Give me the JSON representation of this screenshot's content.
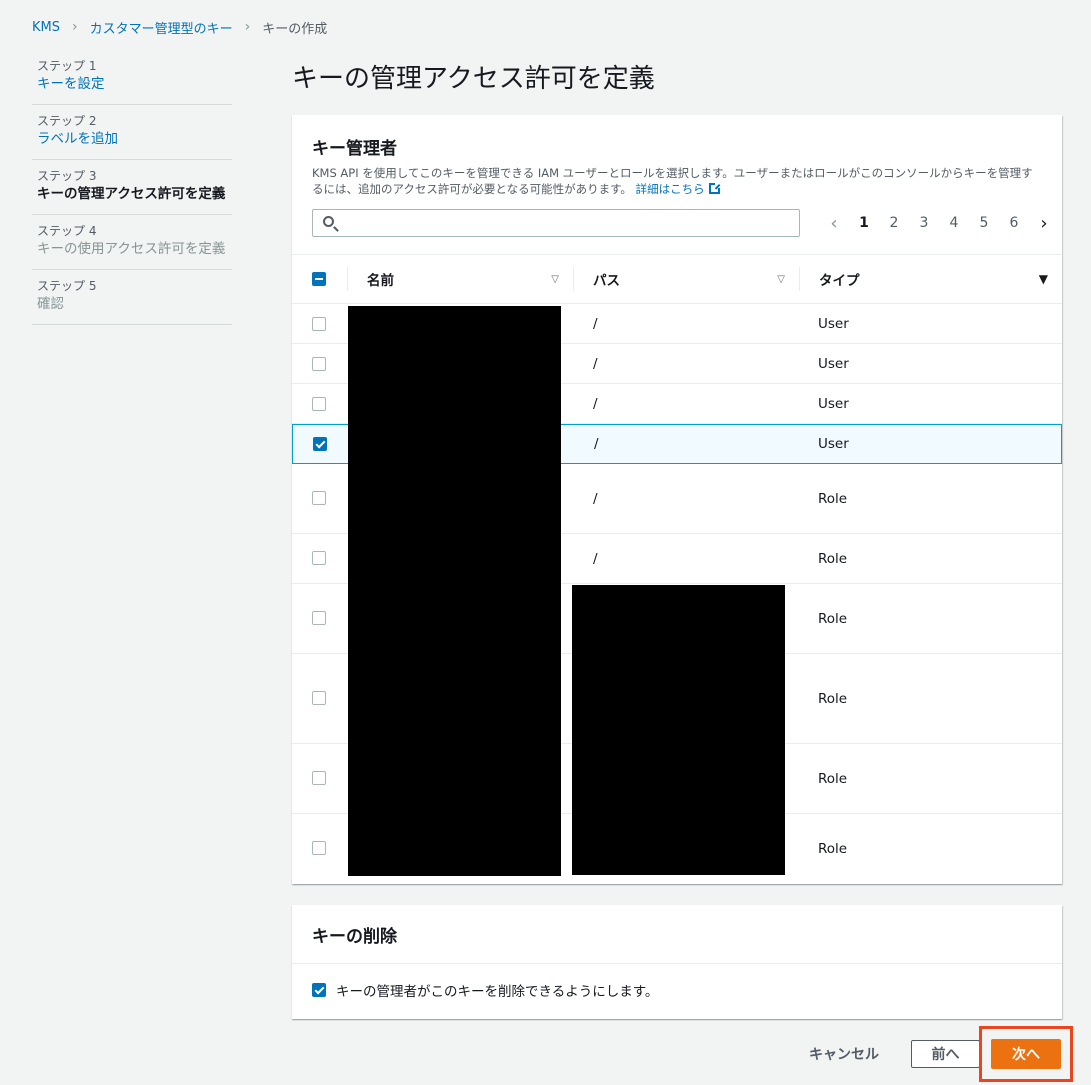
{
  "breadcrumb": [
    {
      "label": "KMS"
    },
    {
      "label": "カスタマー管理型のキー"
    },
    {
      "label": "キーの作成"
    }
  ],
  "steps": [
    {
      "num": "ステップ 1",
      "label": "キーを設定",
      "state": "link"
    },
    {
      "num": "ステップ 2",
      "label": "ラベルを追加",
      "state": "link"
    },
    {
      "num": "ステップ 3",
      "label": "キーの管理アクセス許可を定義",
      "state": "active"
    },
    {
      "num": "ステップ 4",
      "label": "キーの使用アクセス許可を定義",
      "state": "disabled"
    },
    {
      "num": "ステップ 5",
      "label": "確認",
      "state": "disabled"
    }
  ],
  "page_title": "キーの管理アクセス許可を定義",
  "admins": {
    "title": "キー管理者",
    "description": "KMS API を使用してこのキーを管理できる IAM ユーザーとロールを選択します。ユーザーまたはロールがこのコンソールからキーを管理するには、追加のアクセス許可が必要となる可能性があります。",
    "learn_more": "詳細はこちら",
    "search_placeholder": "",
    "pagination": [
      "1",
      "2",
      "3",
      "4",
      "5",
      "6"
    ],
    "current_page": "1",
    "columns": {
      "name": "名前",
      "path": "パス",
      "type": "タイプ"
    },
    "rows": [
      {
        "path": "/",
        "type": "User",
        "checked": false
      },
      {
        "path": "/",
        "type": "User",
        "checked": false
      },
      {
        "path": "/",
        "type": "User",
        "checked": false
      },
      {
        "path": "/",
        "type": "User",
        "checked": true
      },
      {
        "path": "/",
        "type": "Role",
        "checked": false
      },
      {
        "path": "/",
        "type": "Role",
        "checked": false
      },
      {
        "path": "",
        "type": "Role",
        "checked": false
      },
      {
        "path": "",
        "type": "Role",
        "checked": false
      },
      {
        "path": "",
        "type": "Role",
        "checked": false
      },
      {
        "path": "",
        "type": "Role",
        "checked": false
      }
    ]
  },
  "deletion": {
    "title": "キーの削除",
    "option_label": "キーの管理者がこのキーを削除できるようにします。",
    "checked": true
  },
  "footer": {
    "cancel": "キャンセル",
    "previous": "前へ",
    "next": "次へ"
  },
  "colors": {
    "link": "#0073bb",
    "primary_button": "#ec7211",
    "highlight_box": "#e8461f",
    "selected_row": "#f1faff"
  }
}
